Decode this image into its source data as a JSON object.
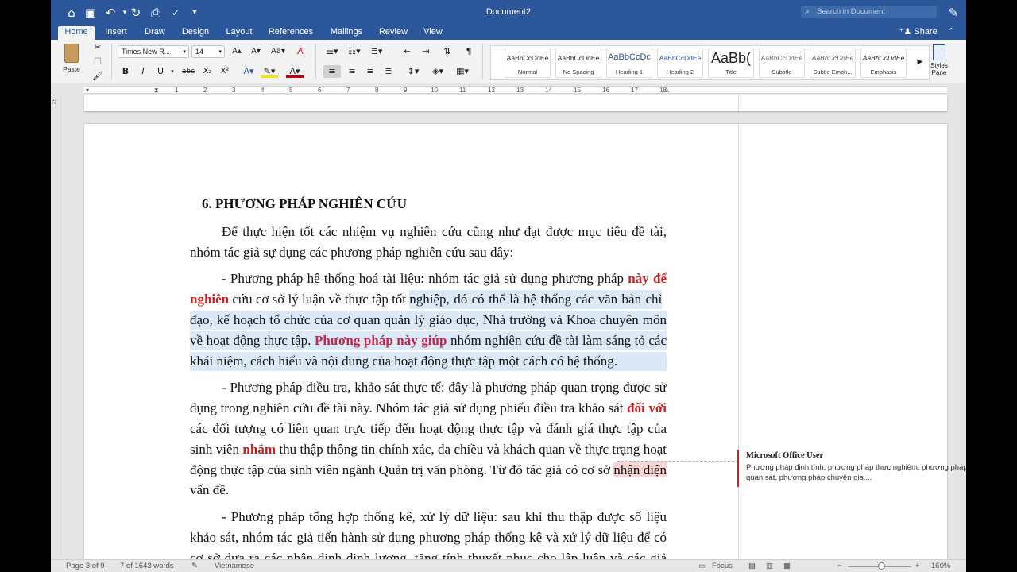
{
  "window": {
    "title": "Document2",
    "search_placeholder": "Search in Document"
  },
  "tabs": [
    "Home",
    "Insert",
    "Draw",
    "Design",
    "Layout",
    "References",
    "Mailings",
    "Review",
    "View"
  ],
  "share_label": "Share",
  "ribbon": {
    "paste_label": "Paste",
    "font_name": "Times New R...",
    "font_size": "14",
    "styles": [
      {
        "sample": "AaBbCcDdEe",
        "name": "Normal"
      },
      {
        "sample": "AaBbCcDdEe",
        "name": "No Spacing"
      },
      {
        "sample": "AaBbCcDc",
        "name": "Heading 1"
      },
      {
        "sample": "AaBbCcDdEe",
        "name": "Heading 2"
      },
      {
        "sample": "AaBb(",
        "name": "Title"
      },
      {
        "sample": "AaBbCcDdEe",
        "name": "Subtitle"
      },
      {
        "sample": "AaBbCcDdEe",
        "name": "Subtle Emph..."
      },
      {
        "sample": "AaBbCcDdEe",
        "name": "Emphasis"
      }
    ],
    "styles_pane_label": "Styles\nPane"
  },
  "ruler": {
    "numbers": [
      "1",
      "2",
      "3",
      "4",
      "5",
      "6",
      "7",
      "8",
      "9",
      "10",
      "11",
      "12",
      "13",
      "14",
      "15",
      "16",
      "17",
      "18"
    ],
    "vertical_number": "25"
  },
  "document": {
    "heading": "6.  PHƯƠNG PHÁP NGHIÊN CỨU",
    "lines": [
      "Để thực hiện tốt các nhiệm vụ nghiên cứu cũng như đạt được mục tiêu đề tài,",
      "nhóm tác giả sự dụng các phương pháp nghiên cứu sau đây:",
      "- Phương pháp hệ thống hoá tài liệu: nhóm tác giả sử dụng phương pháp ",
      "này để",
      "nghiên",
      " cứu cơ sở lý luận về thực tập tốt ",
      "nghiệp, đó có thể là hệ thống các văn bản chỉ",
      "đạo, kế hoạch tổ chức của cơ quan quản lý giáo dục, Nhà trường và Khoa chuyên môn",
      "về hoạt động thực tập. ",
      "Phương pháp này giúp",
      " nhóm nghiên cứu đề tài làm sáng tỏ các",
      "khái niệm, cách hiểu và nội dung của hoạt động thực tập một cách có hệ thống.",
      "- Phương pháp điều tra, khảo sát thực tế: đây là phương pháp quan trọng được sử",
      "dụng trong nghiên cứu đề tài này. Nhóm tác giả sử dụng phiếu điều tra khảo sát ",
      "đối với",
      "các đối tượng có liên quan trực tiếp đến hoạt động thực tập và đánh giá thực tập của",
      "sinh viên ",
      "nhắm",
      " thu thập thông tin chính xác, đa chiều và khách quan về thực trạng hoạt",
      "động thực tập của sinh viên ngành Quản trị văn phòng. Từ đó tác giả có cơ sở ",
      "nhận diện",
      "vấn đề.",
      "- Phương pháp tổng hợp thống kê, xử lý dữ liệu: sau khi thu thập được số liệu",
      "khảo sát, nhóm tác giả tiến hành sử dụng phương pháp thống kê và xử lý dữ liệu để có",
      "cơ sở đưa ra các nhận định định lượng, tăng tính thuyết phục cho lập luận và các giả"
    ]
  },
  "comment": {
    "author": "Microsoft Office User",
    "text": "Phương pháp định tính, phương pháp thực nghiệm, phương pháp quan sát, phương pháp chuyên gia...."
  },
  "status": {
    "page": "Page 3 of 9",
    "words": "7 of 1643 words",
    "language": "Vietnamese",
    "focus": "Focus",
    "zoom": "160%"
  }
}
